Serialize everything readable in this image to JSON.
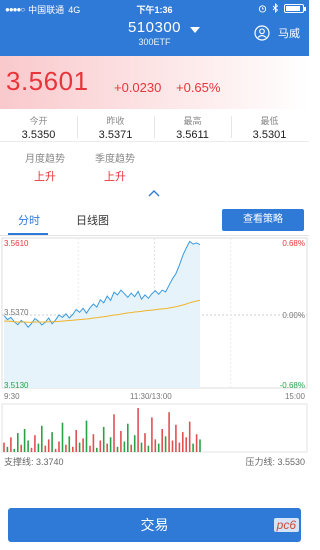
{
  "status_bar": {
    "carrier": "中国联通",
    "network": "4G",
    "time": "下午1:36",
    "battery_level": 0.9
  },
  "header": {
    "code": "510300",
    "name": "300ETF",
    "user_name": "马威"
  },
  "quote": {
    "price": "3.5601",
    "change": "+0.0230",
    "change_pct": "+0.65%"
  },
  "stats": [
    {
      "label": "今开",
      "value": "3.5350"
    },
    {
      "label": "昨收",
      "value": "3.5371"
    },
    {
      "label": "最高",
      "value": "3.5611"
    },
    {
      "label": "最低",
      "value": "3.5301"
    }
  ],
  "trends": [
    {
      "label": "月度趋势",
      "value": "上升"
    },
    {
      "label": "季度趋势",
      "value": "上升"
    }
  ],
  "tabs": [
    {
      "label": "分时",
      "active": true
    },
    {
      "label": "日线图",
      "active": false
    }
  ],
  "strategy_button": "查看策略",
  "chart_data": {
    "type": "line",
    "y_left_ticks": [
      "3.5610",
      "3.5370",
      "3.5130"
    ],
    "y_right_ticks": [
      "0.68%",
      "0.00%",
      "-0.68%"
    ],
    "x_ticks": [
      "9:30",
      "11:30/13:00",
      "15:00"
    ],
    "ylim": [
      3.513,
      3.561
    ],
    "series": [
      {
        "values": [
          3.5368,
          3.5355,
          3.5362,
          3.5348,
          3.5338,
          3.5352,
          3.5345,
          3.533,
          3.5342,
          3.5358,
          3.535,
          3.5337,
          3.5346,
          3.536,
          3.5341,
          3.5354,
          3.537,
          3.5362,
          3.5374,
          3.536,
          3.5372,
          3.5388,
          3.5379,
          3.5392,
          3.5376,
          3.5394,
          3.5406,
          3.5396,
          3.542,
          3.541,
          3.5432,
          3.5418,
          3.5445,
          3.5436,
          3.5452,
          3.544,
          3.5428,
          3.5442,
          3.543,
          3.5448,
          3.5422,
          3.5436,
          3.5425,
          3.544,
          3.545,
          3.5438,
          3.5452,
          3.5446,
          3.5468,
          3.5489,
          3.5506,
          3.5534,
          3.5566,
          3.559,
          3.5612,
          3.5603,
          3.5607,
          3.5601
        ]
      },
      {
        "values": [
          3.535,
          3.535,
          3.5349,
          3.5348,
          3.5347,
          3.5347,
          3.5347,
          3.5346,
          3.5346,
          3.5347,
          3.5347,
          3.5347,
          3.5347,
          3.5348,
          3.5348,
          3.5348,
          3.5349,
          3.535,
          3.5351,
          3.5352,
          3.5353,
          3.5354,
          3.5355,
          3.5356,
          3.5357,
          3.5358,
          3.536,
          3.5361,
          3.5363,
          3.5364,
          3.5366,
          3.5368,
          3.537,
          3.5371,
          3.5373,
          3.5375,
          3.5377,
          3.5378,
          3.538,
          3.5381,
          3.5382,
          3.5384,
          3.5385,
          3.5386,
          3.5387,
          3.5389,
          3.539,
          3.5391,
          3.5393,
          3.5395,
          3.5397,
          3.54,
          3.5403,
          3.5406,
          3.541,
          3.5413,
          3.5416,
          3.5418
        ]
      }
    ],
    "volume": [
      9,
      5,
      14,
      3,
      18,
      7,
      22,
      11,
      4,
      16,
      8,
      25,
      6,
      12,
      19,
      3,
      10,
      28,
      7,
      15,
      5,
      21,
      9,
      13,
      30,
      6,
      17,
      4,
      11,
      24,
      8,
      14,
      36,
      5,
      20,
      10,
      27,
      7,
      16,
      42,
      9,
      18,
      6,
      33,
      12,
      8,
      22,
      15,
      38,
      11,
      26,
      9,
      19,
      14,
      29,
      8,
      17,
      12
    ],
    "line_colors": [
      "#3a9ae0",
      "#f0b429"
    ],
    "area_fill": "#e6f3fb",
    "volume_colors": [
      "#e05050",
      "#2aa145"
    ]
  },
  "support": {
    "label": "支撑线:",
    "value": "3.3740"
  },
  "pressure": {
    "label": "压力线:",
    "value": "3.5530"
  },
  "trade_button": "交易",
  "watermark": "pc6"
}
